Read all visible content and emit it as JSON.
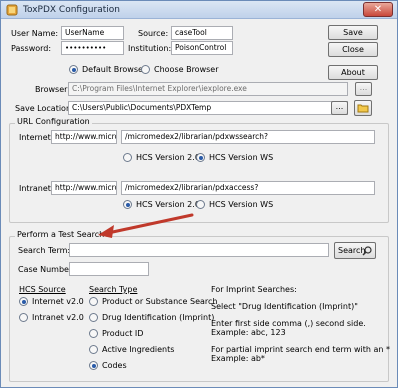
{
  "window": {
    "title": "ToxPDX Configuration",
    "close_glyph": "✕"
  },
  "credentials": {
    "user_name_label": "User Name:",
    "user_name_value": "UserName",
    "password_label": "Password:",
    "password_value": "••••••••••",
    "source_label": "Source:",
    "source_value": "caseTool",
    "institution_label": "Institution:",
    "institution_value": "PoisonControl"
  },
  "buttons": {
    "save": "Save",
    "close": "Close",
    "about": "About",
    "browse_dots": "...",
    "location_dots": "...",
    "search": "Search"
  },
  "browser": {
    "default_label": "Default Browser",
    "choose_label": "Choose Browser",
    "browser_label": "Browser:",
    "browser_value": "C:\\Program Files\\Internet Explorer\\iexplore.exe"
  },
  "save_location": {
    "label": "Save Location:",
    "value": "C:\\Users\\Public\\Documents\\PDXTemp"
  },
  "url_config": {
    "group_title": "URL Configuration",
    "internet_label": "Internet:",
    "internet_host": "http://www.microme",
    "internet_path": "/micromedex2/librarian/pdxwssearch?",
    "intranet_label": "Intranet:",
    "intranet_host": "http://www.microme",
    "intranet_path": "/micromedex2/librarian/pdxaccess?",
    "hcs20_label": "HCS Version 2.0",
    "hcsws_label": "HCS Version WS"
  },
  "test_search": {
    "group_title": "Perform a Test Search",
    "search_term_label": "Search Term:",
    "case_number_label": "Case Number:",
    "hcs_source_heading": "HCS Source",
    "internet_v2": "Internet v2.0",
    "intranet_v2": "Intranet v2.0",
    "search_type_heading": "Search Type",
    "search_types": [
      "Product or Substance Search",
      "Drug Identification (Imprint)",
      "Product ID",
      "Active Ingredients",
      "Codes"
    ],
    "imprint_heading": "For Imprint Searches:",
    "imprint_select": "Select \"Drug Identification (Imprint)\"",
    "imprint_enter_1": "Enter first side comma (,) second side.",
    "imprint_example_1": "Example: abc, 123",
    "imprint_partial_1": "For partial imprint search end term with an *",
    "imprint_example_2": "Example: ab*"
  },
  "colors": {
    "arrow": "#c0392b",
    "radio_dot": "#2a5ba8",
    "title_bar": "#bfd1ea"
  }
}
